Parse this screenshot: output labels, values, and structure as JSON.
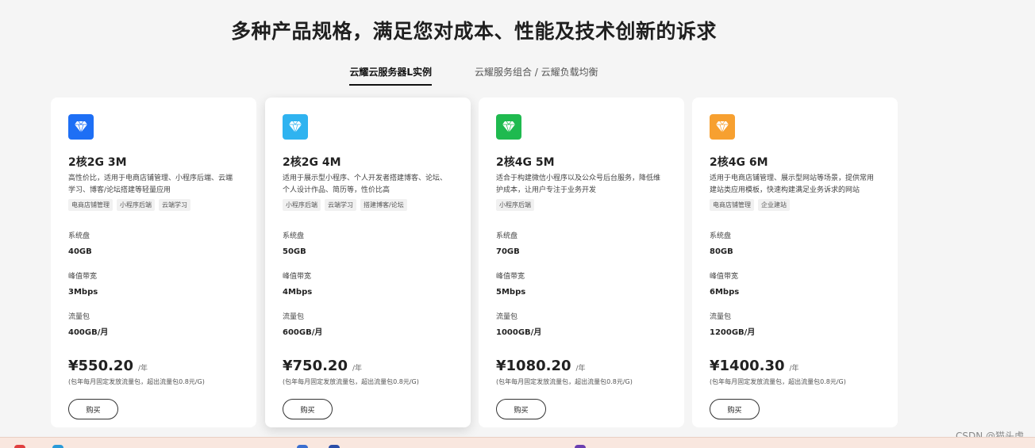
{
  "headline": "多种产品规格，满足您对成本、性能及技术创新的诉求",
  "tabs": [
    {
      "label": "云耀云服务器L实例",
      "active": true
    },
    {
      "label": "云耀服务组合 / 云耀负载均衡",
      "active": false
    }
  ],
  "spec_labels": {
    "disk": "系统盘",
    "bandwidth": "峰值带宽",
    "traffic": "流量包"
  },
  "price_unit": "/年",
  "note": "(包年每月固定发放流量包，超出流量包0.8元/G)",
  "buy_label": "购买",
  "cards": [
    {
      "icon_color": "#1e6ff5",
      "title": "2核2G 3M",
      "desc": "高性价比，适用于电商店铺管理、小程序后端、云端学习、博客/论坛搭建等轻量应用",
      "tags": [
        "电商店铺管理",
        "小程序后端",
        "云端学习"
      ],
      "disk": "40GB",
      "bandwidth": "3Mbps",
      "traffic": "400GB/月",
      "price": "¥550.20"
    },
    {
      "icon_color": "#2fb3f0",
      "title": "2核2G 4M",
      "desc": "适用于展示型小程序、个人开发者搭建博客、论坛、个人设计作品、简历等，性价比高",
      "tags": [
        "小程序后端",
        "云端学习",
        "搭建博客/论坛"
      ],
      "disk": "50GB",
      "bandwidth": "4Mbps",
      "traffic": "600GB/月",
      "price": "¥750.20"
    },
    {
      "icon_color": "#1fba4f",
      "title": "2核4G 5M",
      "desc": "适合于构建微信小程序以及公众号后台服务，降低维护成本，让用户专注于业务开发",
      "tags": [
        "小程序后端"
      ],
      "disk": "70GB",
      "bandwidth": "5Mbps",
      "traffic": "1000GB/月",
      "price": "¥1080.20"
    },
    {
      "icon_color": "#f7a030",
      "title": "2核4G 6M",
      "desc": "适用于电商店铺管理、展示型网站等场景，提供常用建站类应用模板，快速构建满足业务诉求的网站",
      "tags": [
        "电商店铺管理",
        "企业建站"
      ],
      "disk": "80GB",
      "bandwidth": "6Mbps",
      "traffic": "1200GB/月",
      "price": "¥1400.30"
    }
  ],
  "watermark": "CSDN @猫头虎"
}
